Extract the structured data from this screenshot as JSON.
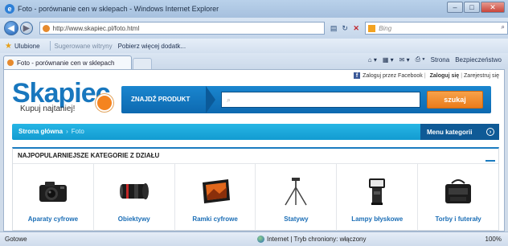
{
  "window": {
    "title": "Foto - porównanie cen w sklepach - Windows Internet Explorer",
    "controls": [
      "–",
      "□",
      "✕"
    ]
  },
  "address_bar": {
    "url": "http://www.skapiec.pl/foto.html",
    "search_engine": "Bing"
  },
  "favorites_bar": {
    "favorites_label": "Ulubione",
    "suggested_label": "Sugerowane witryny",
    "addons_label": "Pobierz więcej dodatk..."
  },
  "tab": {
    "title": "Foto - porównanie cen w sklepach"
  },
  "command_bar": {
    "page_label": "Strona",
    "safety_label": "Bezpieczeństwo"
  },
  "site": {
    "top_links": {
      "facebook": "Zaloguj przez Facebook",
      "login": "Zaloguj się",
      "register": "Zarejestruj się"
    },
    "logo": {
      "brand": "Skapiec",
      "tagline": "Kupuj najtaniej!"
    },
    "search": {
      "label": "ZNAJDŹ PRODUKT",
      "button": "szukaj"
    },
    "breadcrumb": {
      "home": "Strona główna",
      "current": "Foto"
    },
    "menu_button": "Menu kategorii",
    "section_heading": "NAJPOPULARNIEJSZE KATEGORIE Z DZIAŁU",
    "categories": [
      {
        "name": "Aparaty cyfrowe",
        "icon": "camera-icon"
      },
      {
        "name": "Obiektywy",
        "icon": "lens-icon"
      },
      {
        "name": "Ramki cyfrowe",
        "icon": "photo-frame-icon"
      },
      {
        "name": "Statywy",
        "icon": "tripod-icon"
      },
      {
        "name": "Lampy błyskowe",
        "icon": "flash-icon"
      },
      {
        "name": "Torby i futerały",
        "icon": "bag-icon"
      }
    ]
  },
  "status_bar": {
    "status": "Gotowe",
    "zone": "Internet | Tryb chroniony: włączony",
    "zoom": "100%"
  },
  "colors": {
    "brand_blue": "#1877be",
    "accent_orange": "#ea7b1b",
    "breadcrumb_cyan": "#129bd1",
    "menu_navy": "#0f5a96"
  }
}
